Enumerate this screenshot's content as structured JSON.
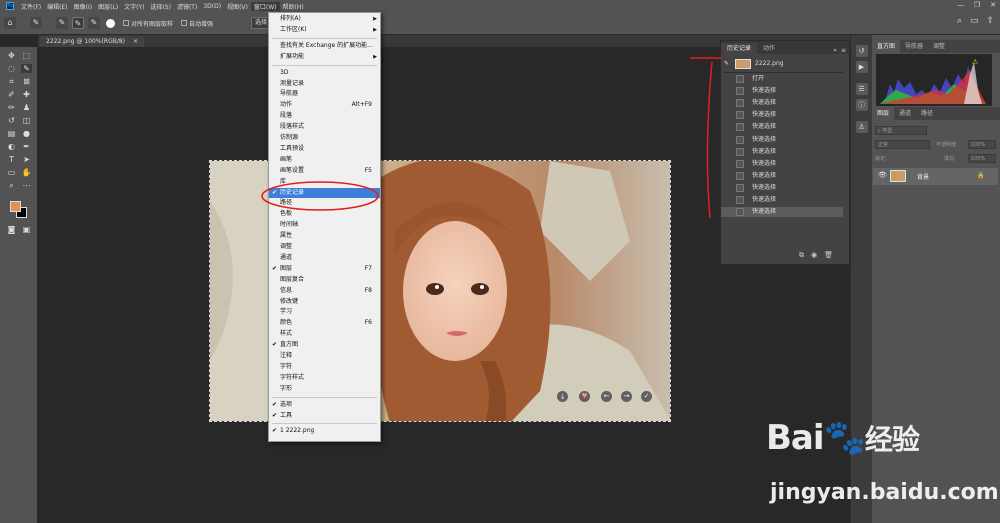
{
  "app": {
    "logo": "Ps",
    "menu": [
      "文件(F)",
      "编辑(E)",
      "图像(I)",
      "图层(L)",
      "文字(Y)",
      "选择(S)",
      "滤镜(T)",
      "3D(D)",
      "视图(V)",
      "窗口(W)",
      "帮助(H)"
    ]
  },
  "options": {
    "all_layers": "对所有图层取样",
    "auto_enhance": "自动增强",
    "select_subject": "选择主体"
  },
  "document": {
    "tab": "2222.png @ 100%(RGB/8)"
  },
  "window_menu": {
    "items": [
      {
        "label": "排列(A)",
        "sub": true
      },
      {
        "label": "工作区(K)",
        "sub": true
      },
      {
        "sep": true
      },
      {
        "label": "查找有关 Exchange 的扩展功能..."
      },
      {
        "label": "扩展功能",
        "sub": true
      },
      {
        "sep": true
      },
      {
        "label": "3D"
      },
      {
        "label": "测量记录"
      },
      {
        "label": "导航器"
      },
      {
        "label": "动作",
        "shortcut": "Alt+F9"
      },
      {
        "label": "段落"
      },
      {
        "label": "段落样式"
      },
      {
        "label": "仿制源"
      },
      {
        "label": "工具预设"
      },
      {
        "label": "画笔"
      },
      {
        "label": "画笔设置",
        "shortcut": "F5"
      },
      {
        "label": "库"
      },
      {
        "label": "历史记录",
        "checked": true,
        "highlight": true
      },
      {
        "label": "路径"
      },
      {
        "label": "色板"
      },
      {
        "label": "时间轴"
      },
      {
        "label": "属性"
      },
      {
        "label": "调整"
      },
      {
        "label": "通道"
      },
      {
        "label": "图层",
        "checked": true,
        "shortcut": "F7"
      },
      {
        "label": "图层复合"
      },
      {
        "label": "信息",
        "shortcut": "F8"
      },
      {
        "label": "修改键"
      },
      {
        "label": "学习"
      },
      {
        "label": "颜色",
        "shortcut": "F6"
      },
      {
        "label": "样式"
      },
      {
        "label": "直方图",
        "checked": true
      },
      {
        "label": "注释"
      },
      {
        "label": "字符"
      },
      {
        "label": "字符样式"
      },
      {
        "label": "字形"
      },
      {
        "sep": true
      },
      {
        "label": "选项",
        "checked": true
      },
      {
        "label": "工具",
        "checked": true
      },
      {
        "sep": true
      },
      {
        "label": "1 2222.png",
        "checked": true
      }
    ]
  },
  "history": {
    "tabs": [
      "历史记录",
      "动作"
    ],
    "snapshot": "2222.png",
    "steps": [
      "打开",
      "快速选择",
      "快速选择",
      "快速选择",
      "快速选择",
      "快速选择",
      "快速选择",
      "快速选择",
      "快速选择",
      "快速选择",
      "快速选择",
      "快速选择"
    ]
  },
  "right_panel": {
    "top_tabs": [
      "直方图",
      "导航器",
      "调整"
    ],
    "layer_tabs": [
      "图层",
      "通道",
      "路径"
    ],
    "kind_search": "类型",
    "blend": "正常",
    "opacity_label": "不透明度:",
    "opacity_value": "100%",
    "lock_label": "锁定:",
    "fill_label": "填充:",
    "fill_value": "100%",
    "layer_name": "背景"
  },
  "watermark": {
    "brand": "Bai",
    "brand2": "经验",
    "url": "jingyan.baidu.com"
  },
  "colors": {
    "foreground": "#e29150",
    "background": "#000000",
    "highlight": "#3d7ed8",
    "annotation": "#e02020"
  }
}
